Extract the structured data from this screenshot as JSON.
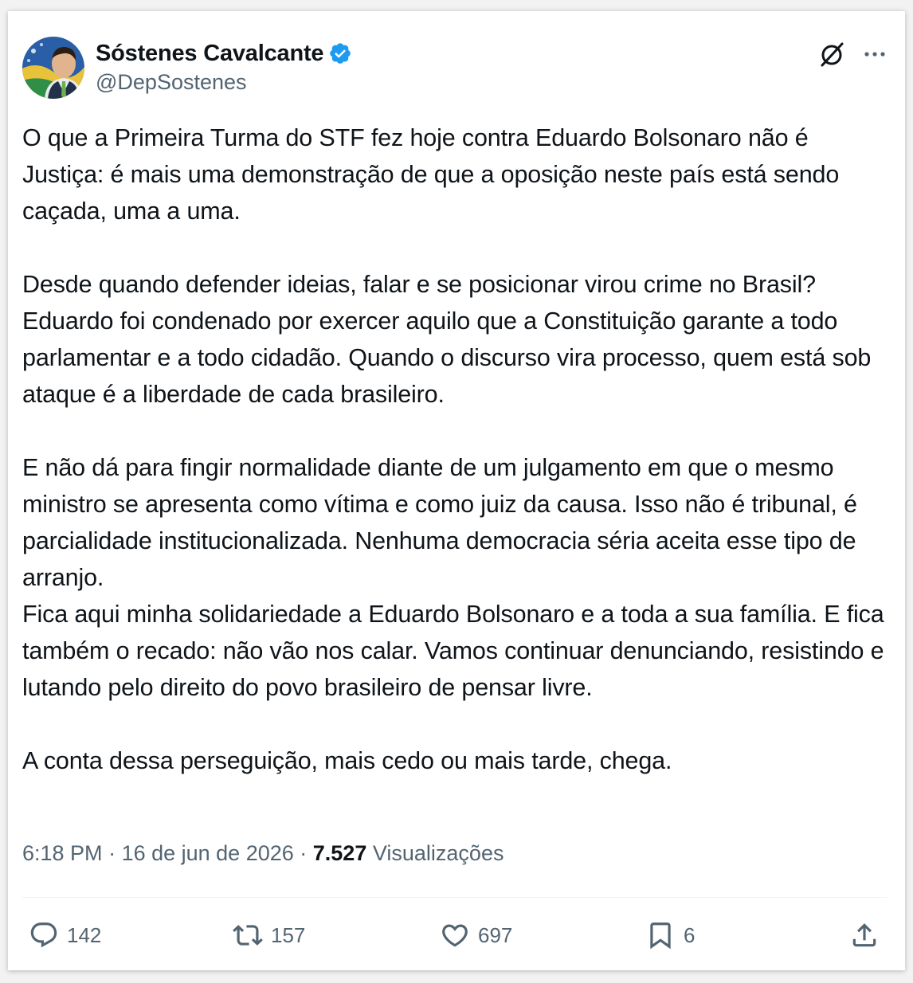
{
  "author": {
    "display_name": "Sóstenes Cavalcante",
    "handle": "@DepSostenes",
    "verified": true
  },
  "paragraphs": [
    "O que a Primeira Turma do STF fez hoje contra Eduardo Bolsonaro não é Justiça: é mais uma demonstração de que a oposição neste país está sendo caçada, uma a uma.",
    "Desde quando defender ideias, falar e se posicionar virou crime no Brasil? Eduardo foi condenado por exercer aquilo que a Constituição garante a todo parlamentar e a todo cidadão. Quando o discurso vira processo, quem está sob ataque é a liberdade de cada brasileiro.",
    "E não dá para fingir normalidade diante de um julgamento em que o mesmo ministro se apresenta como vítima e como juiz da causa. Isso não é tribunal, é parcialidade institucionalizada. Nenhuma democracia séria aceita esse tipo de arranjo.\nFica aqui minha solidariedade a Eduardo Bolsonaro e a toda a sua família. E fica também o recado: não vão nos calar. Vamos continuar denunciando, resistindo e lutando pelo direito do povo brasileiro de pensar livre.",
    "A conta dessa perseguição, mais cedo ou mais tarde, chega."
  ],
  "meta": {
    "time": "6:18 PM",
    "separator": " · ",
    "date": "16 de jun de 2026",
    "views_count": "7.527",
    "views_label": "Visualizações"
  },
  "actions": {
    "replies": "142",
    "reposts": "157",
    "likes": "697",
    "bookmarks": "6"
  },
  "colors": {
    "text": "#0f1419",
    "secondary": "#536471",
    "verified": "#1d9bf0",
    "divider": "#eff3f4"
  },
  "icons": [
    "verified-badge-icon",
    "grok-icon",
    "more-icon",
    "reply-icon",
    "retweet-icon",
    "like-icon",
    "bookmark-icon",
    "share-icon"
  ]
}
